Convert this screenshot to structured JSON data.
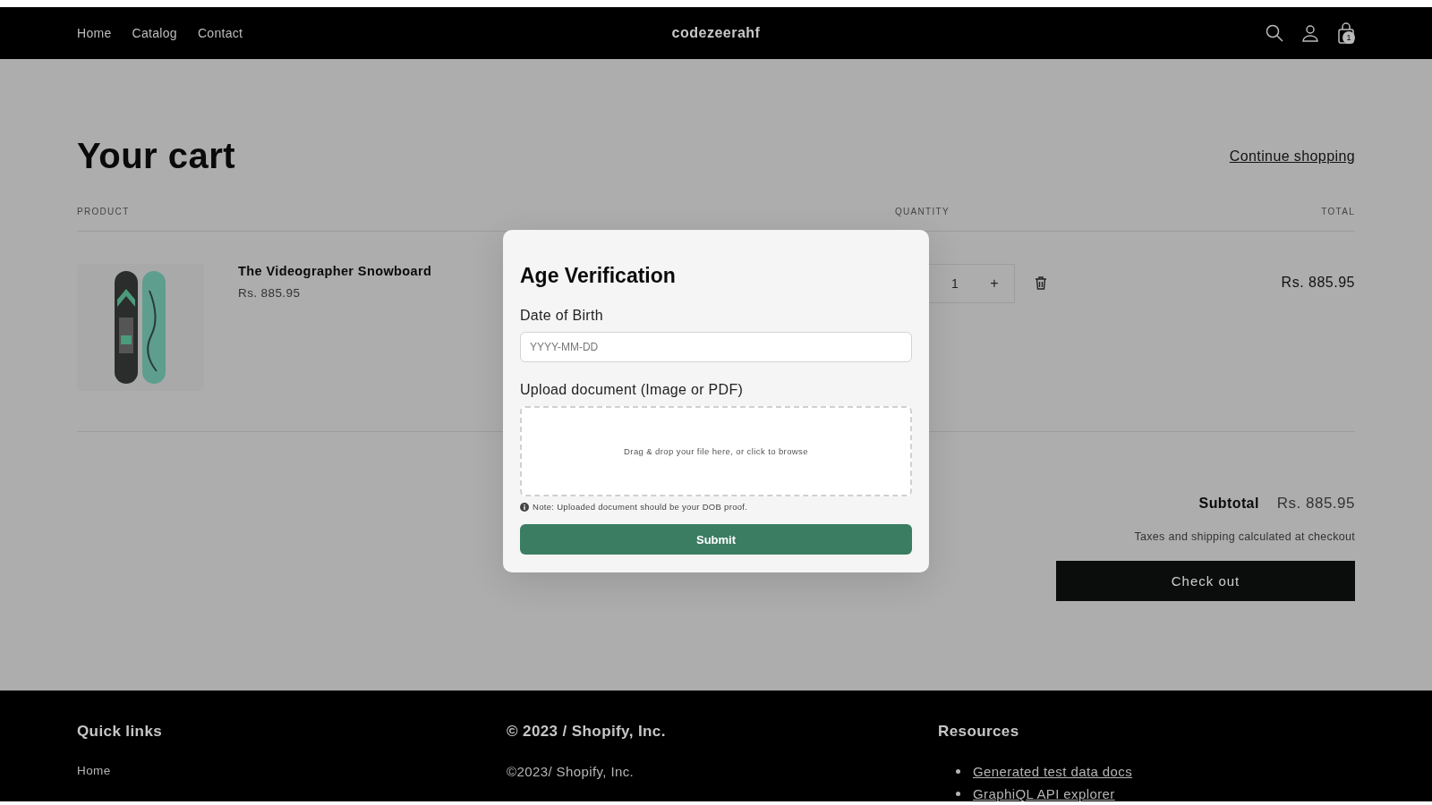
{
  "header": {
    "nav": [
      "Home",
      "Catalog",
      "Contact"
    ],
    "logo": "codezeerahf",
    "cart_count": "1"
  },
  "cart": {
    "title": "Your cart",
    "continue": "Continue shopping",
    "columns": [
      "PRODUCT",
      "QUANTITY",
      "TOTAL"
    ],
    "items": [
      {
        "name": "The Videographer Snowboard",
        "price": "Rs. 885.95",
        "quantity": "1",
        "plus": "+",
        "total": "Rs. 885.95"
      }
    ],
    "subtotal_label": "Subtotal",
    "subtotal": "Rs. 885.95",
    "taxes_note": "Taxes and shipping calculated at checkout",
    "checkout": "Check out"
  },
  "modal": {
    "title": "Age Verification",
    "dob_label": "Date of Birth",
    "dob_placeholder": "YYYY-MM-DD",
    "upload_label": "Upload document (Image or PDF)",
    "dropzone": "Drag & drop your file here, or click to browse",
    "note": "Note: Uploaded document should be your DOB proof.",
    "submit": "Submit"
  },
  "footer": {
    "columns": [
      {
        "heading": "Quick links",
        "kind": "links",
        "items": [
          "Home"
        ]
      },
      {
        "heading": "© 2023 / Shopify, Inc.",
        "kind": "text",
        "items": [
          "©2023/ Shopify, Inc."
        ]
      },
      {
        "heading": "Resources",
        "kind": "bullets",
        "items": [
          "Generated test data docs",
          "GraphiQL API explorer"
        ]
      }
    ]
  }
}
